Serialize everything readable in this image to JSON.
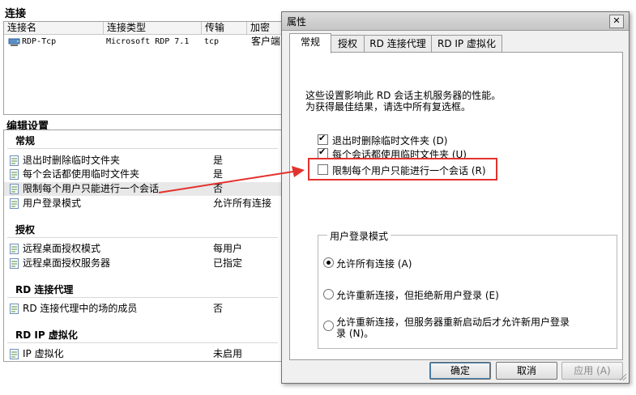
{
  "left": {
    "connections_title": "连接",
    "conn_columns": [
      "连接名",
      "连接类型",
      "传输",
      "加密"
    ],
    "conn_rows": [
      {
        "name": "RDP-Tcp",
        "type": "Microsoft RDP 7.1",
        "transport": "tcp",
        "encryption": "客户端"
      }
    ],
    "edit_title": "编辑设置",
    "groups": [
      {
        "title": "常规",
        "items": [
          {
            "name": "退出时删除临时文件夹",
            "value": "是"
          },
          {
            "name": "每个会话都使用临时文件夹",
            "value": "是"
          },
          {
            "name": "限制每个用户只能进行一个会话",
            "value": "否"
          },
          {
            "name": "用户登录模式",
            "value": "允许所有连接"
          }
        ]
      },
      {
        "title": "授权",
        "items": [
          {
            "name": "远程桌面授权模式",
            "value": "每用户"
          },
          {
            "name": "远程桌面授权服务器",
            "value": "已指定"
          }
        ]
      },
      {
        "title": "RD 连接代理",
        "items": [
          {
            "name": "RD 连接代理中的场的成员",
            "value": "否"
          }
        ]
      },
      {
        "title": "RD IP 虚拟化",
        "items": [
          {
            "name": "IP 虚拟化",
            "value": "未启用"
          }
        ]
      }
    ]
  },
  "dialog": {
    "title": "属性",
    "close_glyph": "✕",
    "tabs": [
      "常规",
      "授权",
      "RD 连接代理",
      "RD IP 虚拟化"
    ],
    "active_tab": "常规",
    "description": [
      "这些设置影响此 RD 会话主机服务器的性能。",
      "为获得最佳结果，请选中所有复选框。"
    ],
    "checkboxes": [
      {
        "label": "退出时删除临时文件夹 (D)",
        "checked": true
      },
      {
        "label": "每个会话都使用临时文件夹 (U)",
        "checked": true
      },
      {
        "label": "限制每个用户只能进行一个会话 (R)",
        "checked": false
      }
    ],
    "login_group_title": "用户登录模式",
    "radios": [
      {
        "label": "允许所有连接 (A)",
        "selected": true
      },
      {
        "label": "允许重新连接，但拒绝新用户登录 (E)",
        "selected": false
      },
      {
        "label_line1": "允许重新连接，但服务器重新启动后才允许新用户登录",
        "label_line2": "录 (N)。",
        "selected": false
      }
    ],
    "buttons": {
      "ok": "确定",
      "cancel": "取消",
      "apply": "应用 (A)"
    }
  },
  "colors": {
    "annotation": "#e3322e",
    "selected_row": "#e8e8e8",
    "dialog_bg": "#f0f0f0"
  }
}
